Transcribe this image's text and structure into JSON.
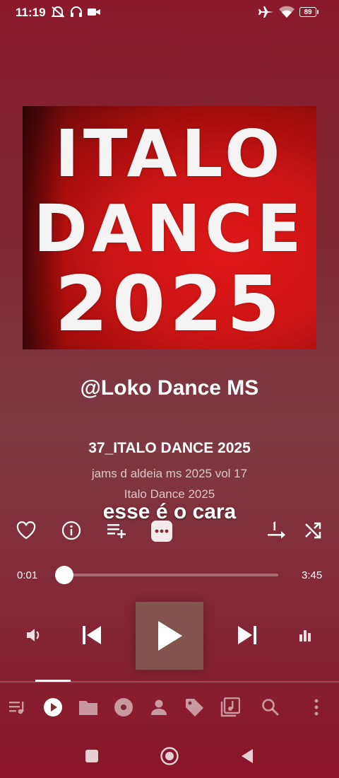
{
  "status": {
    "time": "11:19",
    "battery": "89",
    "icons": [
      "mute-icon",
      "headphones-icon",
      "video-camera-icon",
      "airplane-mode-icon",
      "wifi-icon",
      "battery-icon"
    ]
  },
  "album_art": {
    "lines": [
      "ITALO",
      "DANCE",
      "2025"
    ],
    "background_color": "#d41414"
  },
  "channel": "@Loko Dance MS",
  "song": {
    "title": "37_ITALO DANCE 2025",
    "album": "jams d aldeia ms 2025 vol 17",
    "artist": "Italo Dance 2025"
  },
  "caption": "esse é o cara",
  "progress": {
    "current": "0:01",
    "total": "3:45",
    "fraction": 0.004
  },
  "colors": {
    "background": "#7e2a36",
    "accent": "#ffffff",
    "play_button": "#82594f"
  },
  "bottom_nav": [
    "queue-icon",
    "now-playing-icon",
    "folder-icon",
    "album-icon",
    "artist-icon",
    "tag-icon",
    "playlist-icon",
    "search-icon",
    "more-icon"
  ]
}
